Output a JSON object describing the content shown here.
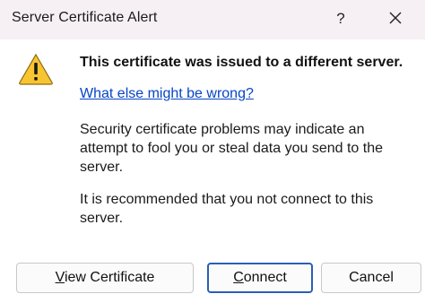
{
  "window": {
    "title": "Server Certificate Alert",
    "help_label": "?",
    "close_icon": "close-icon"
  },
  "message": {
    "icon": "warning-icon",
    "headline": "This certificate was issued to a different server.",
    "link": "What else might be wrong?",
    "paragraph1": "Security certificate problems may indicate an attempt to fool you or steal data you send to the server.",
    "paragraph2": "It is recommended that you not connect to this server."
  },
  "buttons": {
    "view_certificate": {
      "mnemonic": "V",
      "rest": "iew Certificate"
    },
    "connect": {
      "mnemonic": "C",
      "rest": "onnect"
    },
    "cancel": "Cancel"
  },
  "colors": {
    "titlebar_bg": "#f6f0f5",
    "link": "#0645c6",
    "default_button_border": "#2b5fb3",
    "warning_fill": "#f7c531"
  }
}
